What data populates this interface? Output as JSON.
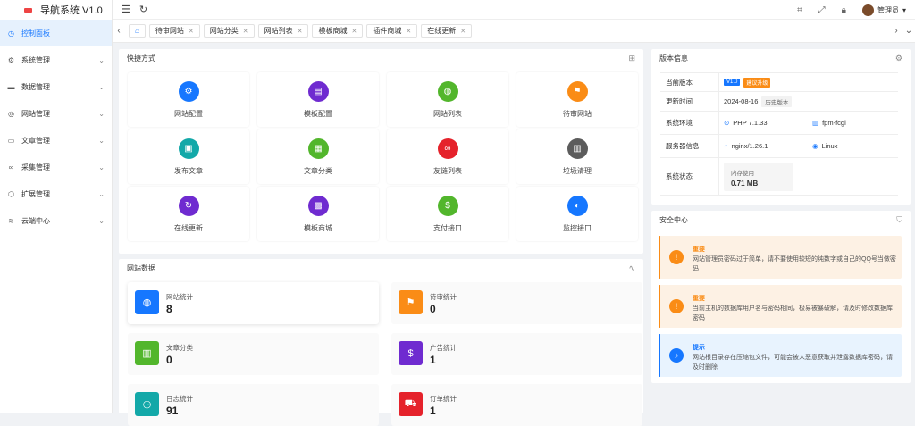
{
  "app": {
    "title": "导航系统 V1.0"
  },
  "sidebar": {
    "items": [
      {
        "label": "控制面板",
        "icon": "dashboard-icon",
        "glyph": "◷",
        "active": true
      },
      {
        "label": "系统管理",
        "icon": "gear-icon",
        "glyph": "⚙"
      },
      {
        "label": "数据管理",
        "icon": "database-icon",
        "glyph": "▬"
      },
      {
        "label": "网站管理",
        "icon": "globe-icon",
        "glyph": "◎"
      },
      {
        "label": "文章管理",
        "icon": "book-icon",
        "glyph": "▭"
      },
      {
        "label": "采集管理",
        "icon": "link-icon",
        "glyph": "∞"
      },
      {
        "label": "扩展管理",
        "icon": "shield-icon",
        "glyph": "⬡"
      },
      {
        "label": "云端中心",
        "icon": "wifi-icon",
        "glyph": "≋"
      }
    ]
  },
  "header": {
    "admin": "管理员"
  },
  "tabs": [
    {
      "label": "待审网站"
    },
    {
      "label": "网站分类"
    },
    {
      "label": "网站列表"
    },
    {
      "label": "模板商城"
    },
    {
      "label": "插件商城"
    },
    {
      "label": "在线更新"
    }
  ],
  "quick": {
    "title": "快捷方式",
    "items": [
      {
        "label": "网站配置",
        "icon": "gear-icon",
        "glyph": "⚙",
        "color": "#1677ff"
      },
      {
        "label": "模板配置",
        "icon": "book-icon",
        "glyph": "▤",
        "color": "#6f2bd0"
      },
      {
        "label": "网站列表",
        "icon": "globe-icon",
        "glyph": "◍",
        "color": "#52b62c"
      },
      {
        "label": "待审网站",
        "icon": "flag-icon",
        "glyph": "⚑",
        "color": "#fa8c16"
      },
      {
        "label": "发布文章",
        "icon": "car-icon",
        "glyph": "▣",
        "color": "#13a8a8"
      },
      {
        "label": "文章分类",
        "icon": "document-icon",
        "glyph": "▦",
        "color": "#52b62c"
      },
      {
        "label": "友链列表",
        "icon": "link-icon",
        "glyph": "∞",
        "color": "#e5222b"
      },
      {
        "label": "垃圾清理",
        "icon": "trash-icon",
        "glyph": "▥",
        "color": "#5c5c5c"
      },
      {
        "label": "在线更新",
        "icon": "refresh-icon",
        "glyph": "↻",
        "color": "#6f2bd0"
      },
      {
        "label": "模板商城",
        "icon": "apps-icon",
        "glyph": "▩",
        "color": "#6f2bd0"
      },
      {
        "label": "支付接口",
        "icon": "dollar-icon",
        "glyph": "$",
        "color": "#52b62c"
      },
      {
        "label": "监控接口",
        "icon": "monitor-icon",
        "glyph": "◐",
        "color": "#1677ff"
      }
    ]
  },
  "stats": {
    "title": "网站数据",
    "items": [
      {
        "label": "网站统计",
        "value": "8",
        "icon": "globe-icon",
        "glyph": "◍",
        "color": "#1677ff"
      },
      {
        "label": "待审统计",
        "value": "0",
        "icon": "flag-icon",
        "glyph": "⚑",
        "color": "#fa8c16"
      },
      {
        "label": "文章分类",
        "value": "0",
        "icon": "book-icon",
        "glyph": "▥",
        "color": "#52b62c"
      },
      {
        "label": "广告统计",
        "value": "1",
        "icon": "dollar-icon",
        "glyph": "$",
        "color": "#6f2bd0"
      },
      {
        "label": "日志统计",
        "value": "91",
        "icon": "clock-icon",
        "glyph": "◷",
        "color": "#13a8a8"
      },
      {
        "label": "订单统计",
        "value": "1",
        "icon": "cart-icon",
        "glyph": "⛟",
        "color": "#e5222b"
      }
    ]
  },
  "version": {
    "title": "版本信息",
    "rows": [
      {
        "key": "当前版本",
        "version": "V1.0",
        "upgrade": "建议升级",
        "version_color": "#1677ff",
        "upgrade_color": "#fa8c16"
      },
      {
        "key": "更新时间",
        "date": "2024-08-16",
        "history": "历史版本"
      },
      {
        "key": "系统环境",
        "php": "PHP 7.1.33",
        "fpm": "fpm-fcgi"
      },
      {
        "key": "服务器信息",
        "nginx": "nginx/1.26.1",
        "os": "Linux"
      },
      {
        "key": "系统状态",
        "mem_label": "内存使用",
        "mem_value": "0.71 MB"
      }
    ]
  },
  "security": {
    "title": "安全中心",
    "alerts": [
      {
        "title": "重要",
        "text": "网站管理员密码过于简单，请不要使用较短的纯数字或自己的QQ号当做密码",
        "type": "warning",
        "color": "#fa8c16",
        "bg": "#fdf1e4"
      },
      {
        "title": "重要",
        "text": "当前主机的数据库用户名与密码相同，极易被暴破解，请及时修改数据库密码",
        "type": "warning",
        "color": "#fa8c16",
        "bg": "#fdf1e4"
      },
      {
        "title": "提示",
        "text": "网站根目录存在压缩包文件，可能会被人恶意获取并泄露数据库密码，请及时删除",
        "type": "info",
        "color": "#1677ff",
        "bg": "#e8f3fe"
      }
    ]
  }
}
